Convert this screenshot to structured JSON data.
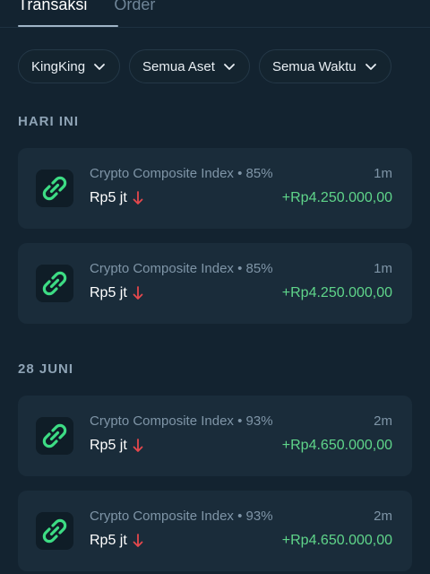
{
  "tabs": [
    {
      "label": "Transaksi"
    },
    {
      "label": "Order"
    }
  ],
  "filters": [
    {
      "label": "KingKing"
    },
    {
      "label": "Semua Aset"
    },
    {
      "label": "Semua Waktu"
    }
  ],
  "sections": [
    {
      "title": "HARI INI",
      "transactions": [
        {
          "asset": "Crypto Composite Index",
          "separator": "•",
          "percent": "85%",
          "time": "1m",
          "amount": "Rp5 jt",
          "profit": "+Rp4.250.000,00"
        },
        {
          "asset": "Crypto Composite Index",
          "separator": "•",
          "percent": "85%",
          "time": "1m",
          "amount": "Rp5 jt",
          "profit": "+Rp4.250.000,00"
        }
      ]
    },
    {
      "title": "28 JUNI",
      "transactions": [
        {
          "asset": "Crypto Composite Index",
          "separator": "•",
          "percent": "93%",
          "time": "2m",
          "amount": "Rp5 jt",
          "profit": "+Rp4.650.000,00"
        },
        {
          "asset": "Crypto Composite Index",
          "separator": "•",
          "percent": "93%",
          "time": "2m",
          "amount": "Rp5 jt",
          "profit": "+Rp4.650.000,00"
        }
      ]
    }
  ],
  "colors": {
    "background": "#132330",
    "card": "#1a2c3a",
    "profit": "#5fd58a",
    "down_arrow": "#e5484d",
    "icon_green": "#3ddc84"
  },
  "icons": {
    "asset_icon": "chain-link-icon",
    "filter_chevron": "chevron-down-icon",
    "direction": "arrow-down-icon"
  }
}
